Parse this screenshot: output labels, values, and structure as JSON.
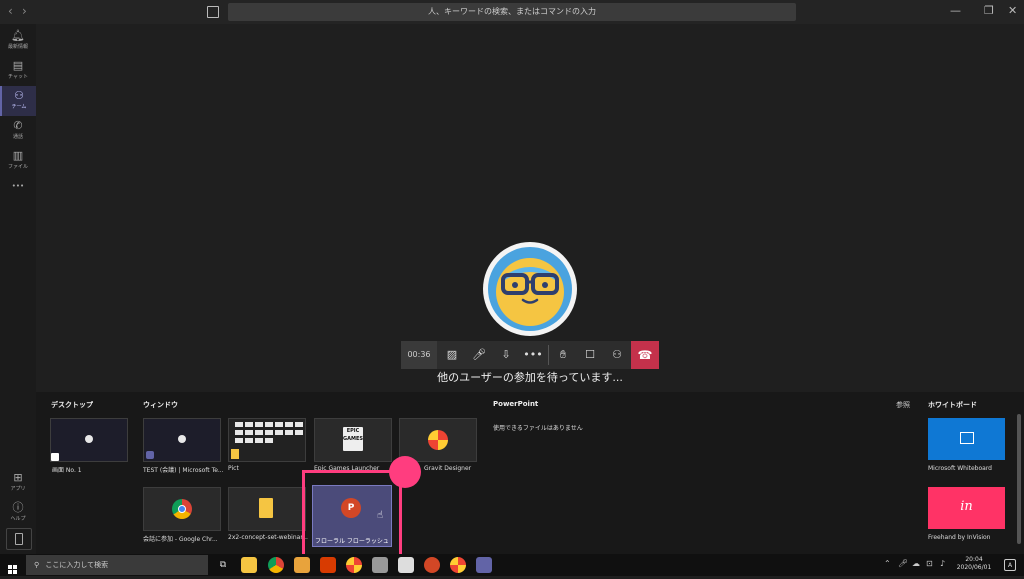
{
  "titlebar": {
    "back": "‹",
    "forward": "›",
    "compose_icon": "compose-icon",
    "search_placeholder": "人、キーワードの検索、またはコマンドの入力",
    "minimize": "—",
    "restore": "❐",
    "close": "✕"
  },
  "rail": {
    "items": [
      {
        "label": "最新情報",
        "icon": "bell-icon"
      },
      {
        "label": "チャット",
        "icon": "chat-icon"
      },
      {
        "label": "チーム",
        "icon": "teams-icon"
      },
      {
        "label": "通話",
        "icon": "phone-icon"
      },
      {
        "label": "ファイル",
        "icon": "file-icon"
      }
    ],
    "more": "•••",
    "apps_label": "アプリ",
    "help_label": "ヘルプ"
  },
  "call": {
    "timer": "00:36",
    "waiting": "他のユーザーの参加を待っています..."
  },
  "tray": {
    "desktop_header": "デスクトップ",
    "window_header": "ウィンドウ",
    "powerpoint_header": "PowerPoint",
    "browse_header": "参照",
    "whiteboard_header": "ホワイトボード",
    "no_files": "使用できるファイルはありません",
    "desktop_items": [
      {
        "label": "画面 No. 1"
      }
    ],
    "windows": [
      {
        "label": "TEST (会議) | Microsoft Te..."
      },
      {
        "label": "Pict"
      },
      {
        "label": "Epic Games Launcher"
      },
      {
        "label": "Gravit Designer"
      },
      {
        "label": "会話に参加 - Google Chr..."
      },
      {
        "label": "2x2-concept-set-webinar..."
      },
      {
        "label": "フローラル フローラッシュ - Po..."
      }
    ],
    "epic_text": "EPIC GAMES",
    "whiteboards": [
      {
        "label": "Microsoft Whiteboard",
        "color": "#0f78d4"
      },
      {
        "label": "Freehand by InVision",
        "color": "#ff3366",
        "mark": "in"
      }
    ]
  },
  "taskbar": {
    "search_placeholder": "ここに入力して検索",
    "time": "20:04",
    "date": "2020/06/01",
    "ime": "A"
  },
  "colors": {
    "accent": "#6264a7",
    "hangup": "#c4314b",
    "highlight": "#ff3d7f"
  }
}
